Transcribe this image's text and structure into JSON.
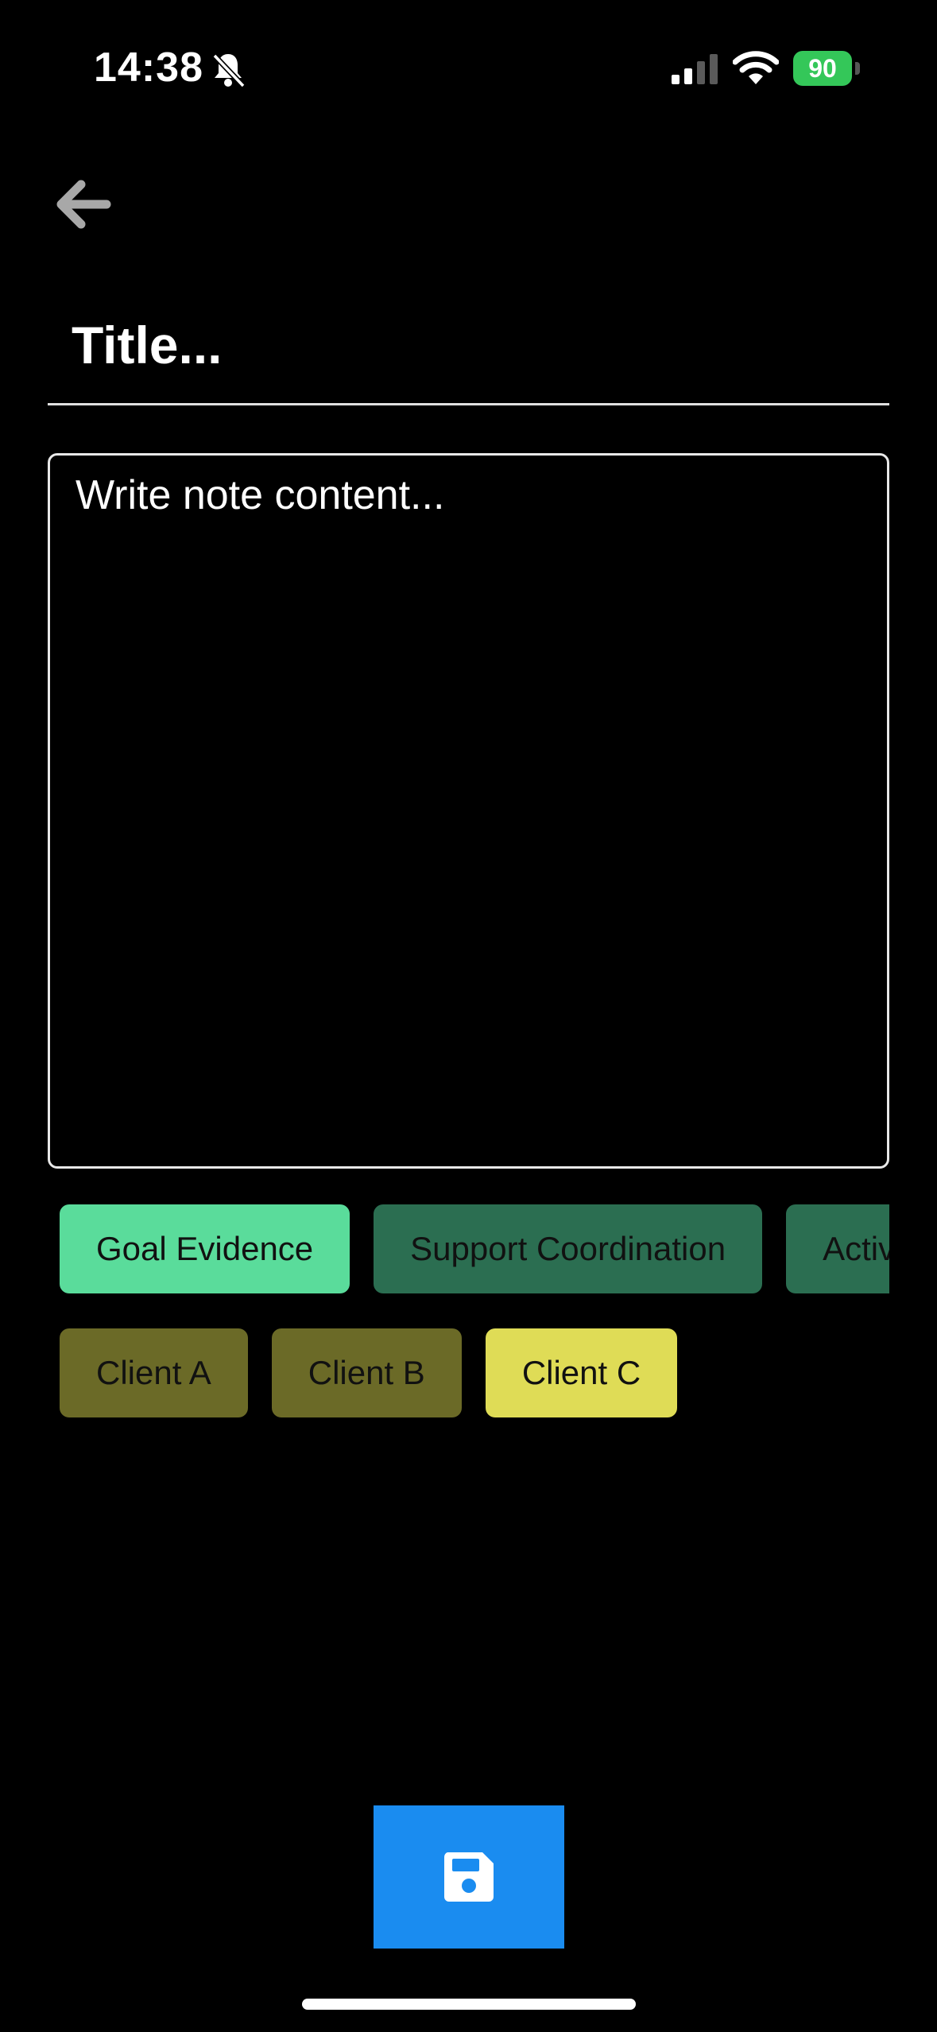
{
  "status_bar": {
    "time": "14:38",
    "battery_level": "90",
    "icons": [
      "bell-slash-icon",
      "cellular-signal-icon",
      "wifi-icon",
      "battery-charging-icon"
    ]
  },
  "navigation": {
    "back_icon": "arrow-left-icon"
  },
  "editor": {
    "title_placeholder": "Title...",
    "title_value": "",
    "content_placeholder": "Write note content...",
    "content_value": ""
  },
  "categories": [
    {
      "label": "Goal Evidence",
      "color": "#5adc9b",
      "selected": true
    },
    {
      "label": "Support Coordination",
      "color": "#2b6e51",
      "selected": false
    },
    {
      "label": "Activities",
      "color": "#2b6e51",
      "selected": false
    }
  ],
  "clients": [
    {
      "label": "Client A",
      "color": "#6b6a27",
      "selected": false
    },
    {
      "label": "Client B",
      "color": "#6b6a27",
      "selected": false
    },
    {
      "label": "Client C",
      "color": "#dfdc56",
      "selected": true
    }
  ],
  "save_button": {
    "icon": "floppy-disk-icon",
    "color": "#1a8cf0"
  }
}
